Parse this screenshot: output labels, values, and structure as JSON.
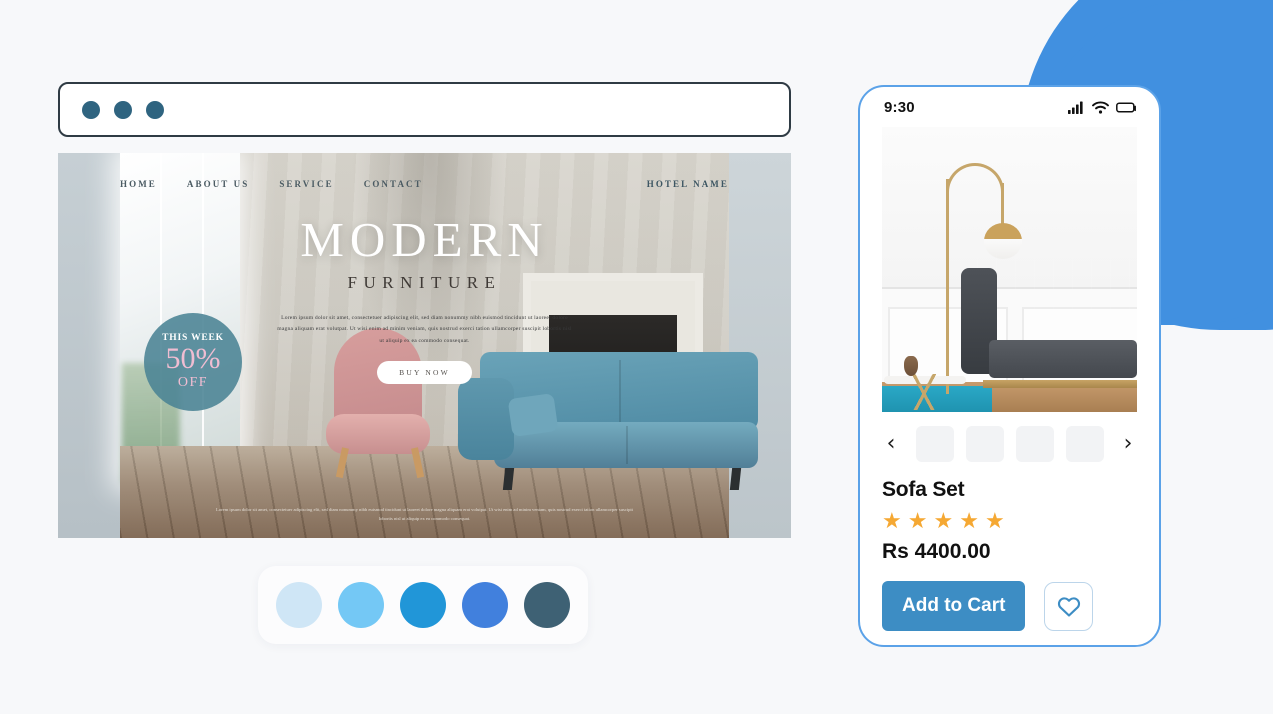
{
  "browser": {
    "dots": [
      "dot-1",
      "dot-2",
      "dot-3"
    ]
  },
  "hero": {
    "nav": [
      "HOME",
      "ABOUT US",
      "SERVICE",
      "CONTACT"
    ],
    "brand": "HOTEL NAME",
    "title": "MODERN",
    "subtitle": "FURNITURE",
    "paragraph": "Lorem ipsum dolor sit amet, consectetuer adipiscing elit, sed diam nonummy nibh euismod tincidunt ut laoreet dolore magna aliquam erat volutpat. Ut wisi enim ad minim veniam, quis nostrud exerci tation ullamcorper suscipit lobortis nisl ut aliquip ex ea commodo consequat.",
    "cta": "BUY NOW",
    "footer_paragraph": "Lorem ipsum dolor sit amet, consectetuer adipiscing elit, sed diam nonummy nibh euismod tincidunt ut laoreet dolore magna aliquam erat volutpat. Ut wisi enim ad minim veniam, quis nostrud exerci tation ullamcorper suscipit lobortis nisl ut aliquip ex ea commodo consequat.",
    "badge": {
      "top": "THIS WEEK",
      "number": "50%",
      "off": "OFF"
    }
  },
  "palette": {
    "swatches": [
      {
        "name": "swatch-lightest",
        "hex": "#cfe6f6"
      },
      {
        "name": "swatch-sky",
        "hex": "#74c8f5"
      },
      {
        "name": "swatch-blue",
        "hex": "#2196d8"
      },
      {
        "name": "swatch-royal",
        "hex": "#4180dd"
      },
      {
        "name": "swatch-slate",
        "hex": "#3e6174"
      }
    ]
  },
  "phone": {
    "status": {
      "time": "9:30",
      "icons": [
        "signal-icon",
        "wifi-icon",
        "battery-icon"
      ]
    },
    "carousel": {
      "prev": "‹",
      "next": "›",
      "thumbnails": [
        "thumb-1",
        "thumb-2",
        "thumb-3",
        "thumb-4"
      ]
    },
    "product": {
      "title": "Sofa Set",
      "rating": 5,
      "star_glyph": "★",
      "price": "Rs 4400.00",
      "add_to_cart": "Add to Cart",
      "favorite_icon": "heart-icon"
    }
  },
  "theme": {
    "accent": "#4190e0",
    "button": "#3d8dc4",
    "star": "#f5a833"
  }
}
